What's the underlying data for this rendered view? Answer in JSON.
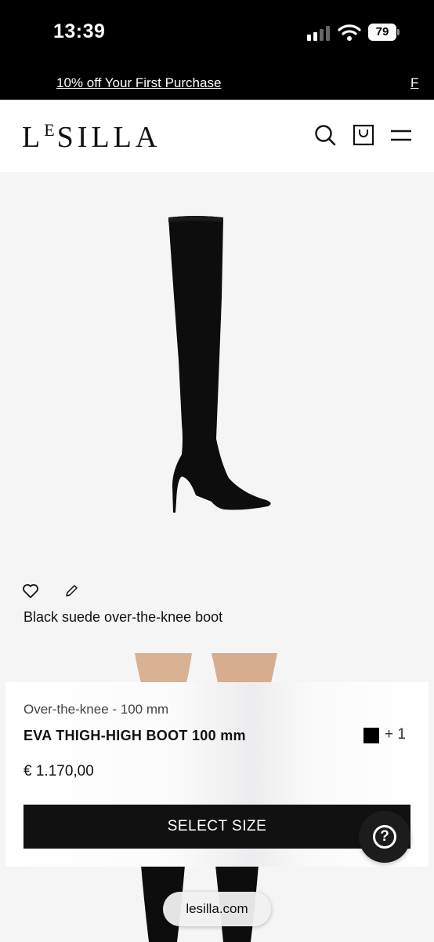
{
  "status_bar": {
    "time": "13:39",
    "battery": "79"
  },
  "promo_bar": {
    "text": "10% off Your First Purchase",
    "next_text": "F"
  },
  "header": {
    "logo_main": "SILLA",
    "logo_prefix": "L",
    "logo_sup": "E"
  },
  "product": {
    "caption": "Black suede over-the-knee boot",
    "category": "Over-the-knee - 100 mm",
    "name": "EVA THIGH-HIGH BOOT 100 mm",
    "swatch_color": "#000000",
    "more_colors": "+ 1",
    "price": "€ 1.170,00",
    "select_size_label": "SELECT SIZE"
  },
  "help": {
    "icon": "question-mark-icon",
    "glyph": "?"
  },
  "browser": {
    "url": "lesilla.com"
  },
  "colors": {
    "background": "#f5f5f6",
    "accent": "#111111"
  }
}
